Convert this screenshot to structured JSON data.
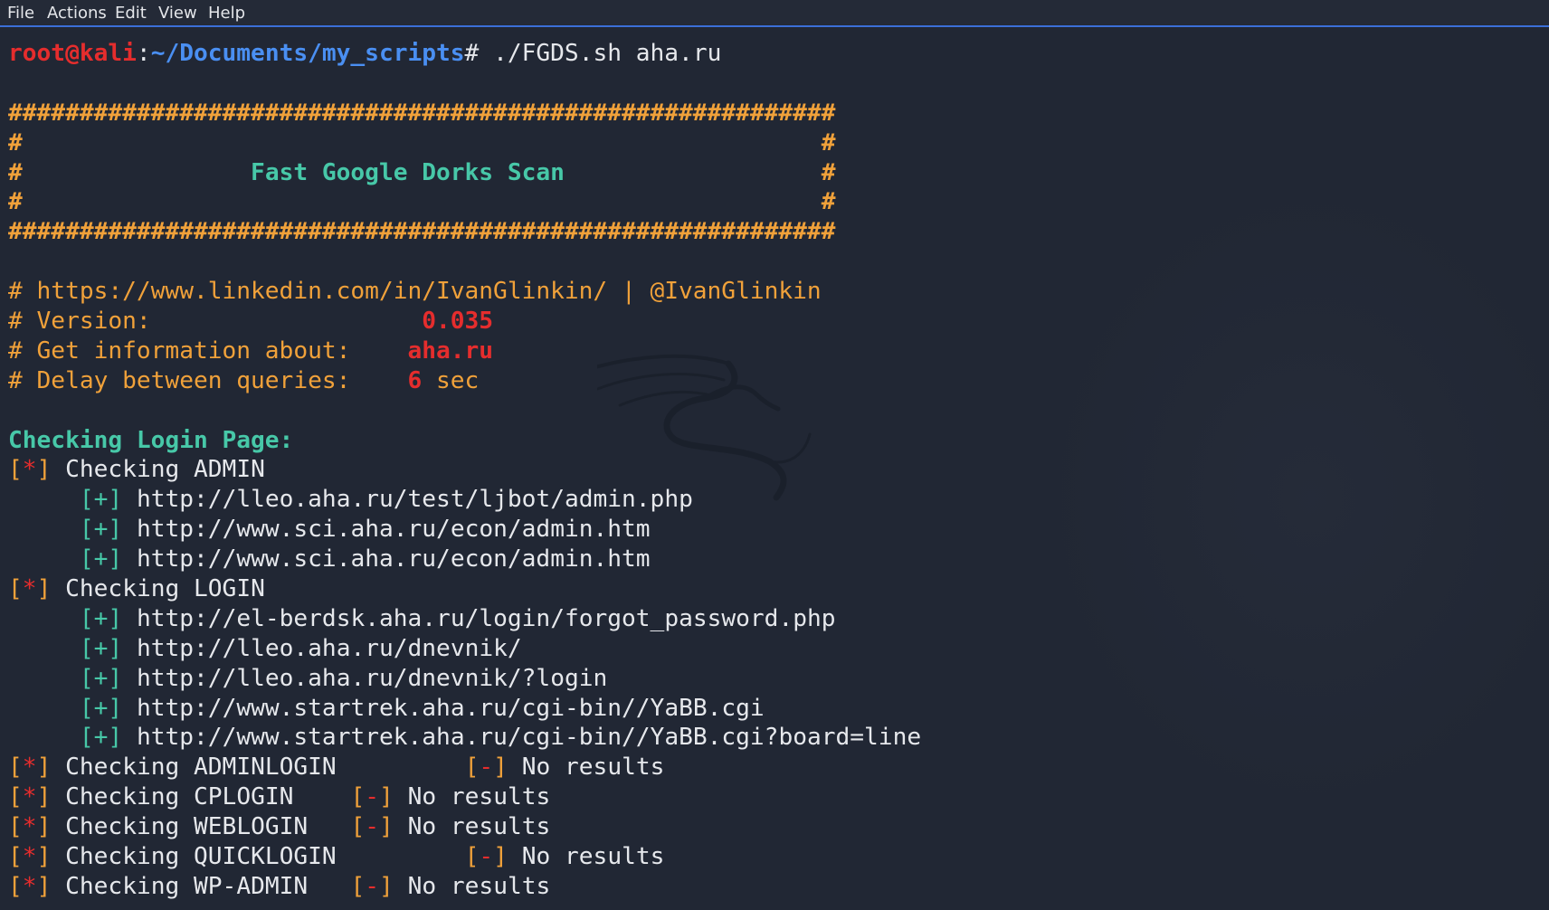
{
  "menu": [
    "File",
    "Actions",
    "Edit",
    "View",
    "Help"
  ],
  "prompt": {
    "user": "root@kali",
    "sep": ":",
    "path": "~/Documents/my_scripts",
    "symbol": "#",
    "command": " ./FGDS.sh aha.ru"
  },
  "banner": {
    "border": "##########################################################",
    "edge_left": "#",
    "edge_right": "#",
    "title": "Fast Google Dorks Scan"
  },
  "info": {
    "link_line": "# https://www.linkedin.com/in/IvanGlinkin/ | @IvanGlinkin",
    "version_label": "# Version:",
    "version_value": "0.035",
    "target_label": "# Get information about:",
    "target_value": "aha.ru",
    "delay_label": "# Delay between queries:",
    "delay_value": "6",
    "delay_unit": " sec"
  },
  "section_title": "Checking Login Page:",
  "markers": {
    "open": "[",
    "close": "]",
    "star": "*",
    "plus": "+",
    "minus": "-"
  },
  "checks": [
    {
      "name": "Checking ADMIN",
      "results": [
        "http://lleo.aha.ru/test/ljbot/admin.php",
        "http://www.sci.aha.ru/econ/admin.htm",
        "http://www.sci.aha.ru/econ/admin.htm"
      ]
    },
    {
      "name": "Checking LOGIN",
      "results": [
        "http://el-berdsk.aha.ru/login/forgot_password.php",
        "http://lleo.aha.ru/dnevnik/",
        "http://lleo.aha.ru/dnevnik/?login",
        "http://www.startrek.aha.ru/cgi-bin//YaBB.cgi",
        "http://www.startrek.aha.ru/cgi-bin//YaBB.cgi?board=line"
      ]
    },
    {
      "name": "Checking ADMINLOGIN",
      "gap": "         ",
      "none": "No results"
    },
    {
      "name": "Checking CPLOGIN",
      "gap": "    ",
      "none": "No results"
    },
    {
      "name": "Checking WEBLOGIN",
      "gap": "   ",
      "none": "No results"
    },
    {
      "name": "Checking QUICKLOGIN",
      "gap": "         ",
      "none": "No results"
    },
    {
      "name": "Checking WP-ADMIN",
      "gap": "   ",
      "none": "No results"
    }
  ]
}
